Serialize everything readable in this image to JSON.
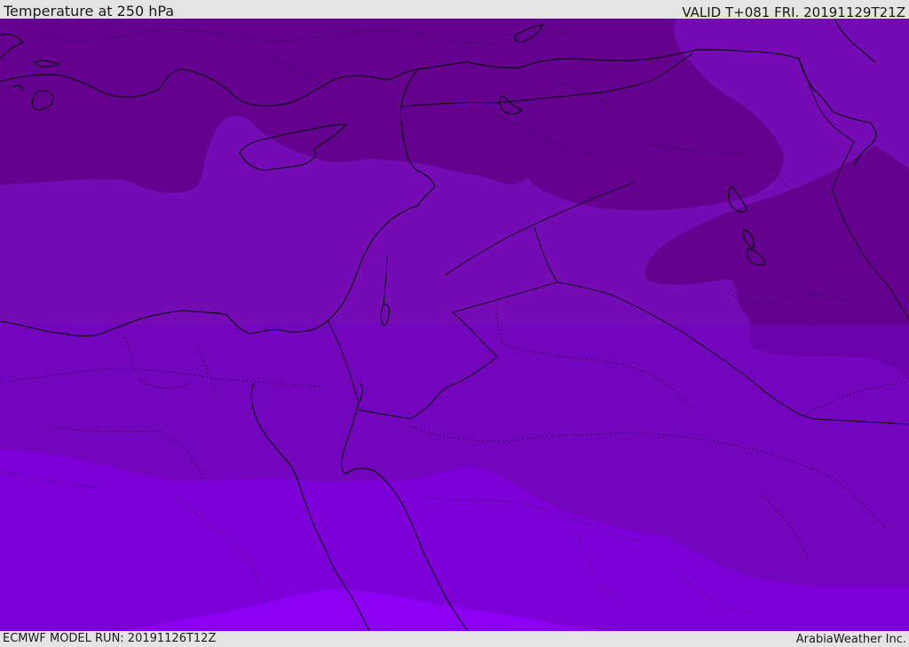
{
  "header": {
    "title": "Temperature at 250 hPa",
    "valid": "VALID T+081 FRI. 20191129T21Z"
  },
  "footer": {
    "model_run": "ECMWF MODEL RUN: 20191126T12Z",
    "brand": "ArabiaWeather Inc."
  },
  "colors": {
    "band_darkest": "#64018f",
    "band_mid": "#740bb5",
    "band_lower": "#7203c3",
    "band_bright": "#7e00d9",
    "band_brightest": "#8c00f4",
    "lines": "#000000"
  },
  "map": {
    "field": "temperature",
    "level": "250 hPa",
    "region": "Eastern Mediterranean / Middle East"
  }
}
